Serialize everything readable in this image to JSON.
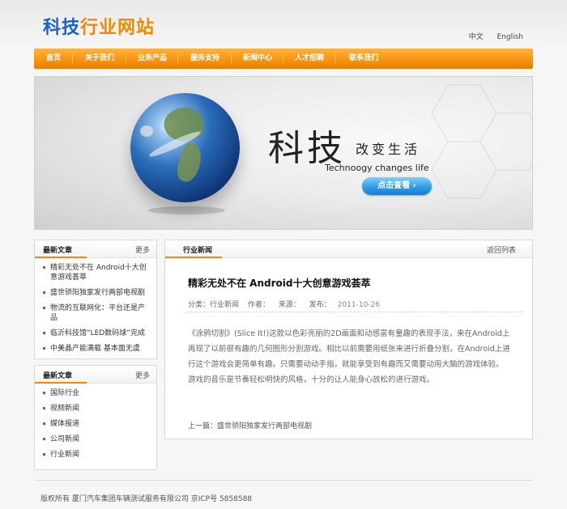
{
  "header": {
    "logo_part1": "科技",
    "logo_part2": "行业网站",
    "lang_zh": "中文",
    "lang_en": "English"
  },
  "nav": [
    "首页",
    "关于我们",
    "业务产品",
    "服务支持",
    "新闻中心",
    "人才招聘",
    "联系我们"
  ],
  "banner": {
    "title": "科技",
    "subtitle": "改变生活",
    "english": "Technoogy changes life",
    "button": "点击查看 ›"
  },
  "latest_articles": {
    "title": "最新文章",
    "more": "更多",
    "items": [
      "精彩无处不在 Android十大创意游戏荟萃",
      "盛世骄阳独家发行两部电视剧",
      "物流的互联网化：平台还是产品",
      "临沂科技馆“LED数码球”完成",
      "中美晶产能满载 基本面无虞"
    ]
  },
  "categories": {
    "title": "最新文章",
    "more": "更多",
    "items": [
      "国际行业",
      "视频新闻",
      "媒体报道",
      "公司新闻",
      "行业新闻"
    ]
  },
  "article": {
    "section": "行业新闻",
    "back": "返回列表",
    "title": "精彩无处不在 Android十大创意游戏荟萃",
    "category": "分类：行业新闻",
    "author": "作者：",
    "source": "来源：",
    "published_label": "发布：",
    "published_date": "2011-10-26",
    "body": "《涂鸦切割》(Slice It!)这款以色彩亮丽的2D画面和动感富有童趣的表现手法，来在Android上再现了以前很有趣的几何图形分割游戏。相比以前需要用纸张来进行折叠分割，在Android上进行这个游戏会更简单有趣。只需要动动手指，就能享受到有趣而又需要动用大脑的游戏体验。游戏的音乐是节奏轻松明快的风格，十分的让人能身心放松的进行游戏。",
    "prev": "上一篇：盛世骄阳独家发行两部电视剧"
  },
  "footer": {
    "text": "版权所有 厦门汽车集团车辆测试服务有限公司   京ICP号 5858588"
  },
  "colors": {
    "brand_blue": "#1a62c6",
    "brand_orange": "#f08a00",
    "button_blue": "#2a9ae6"
  }
}
